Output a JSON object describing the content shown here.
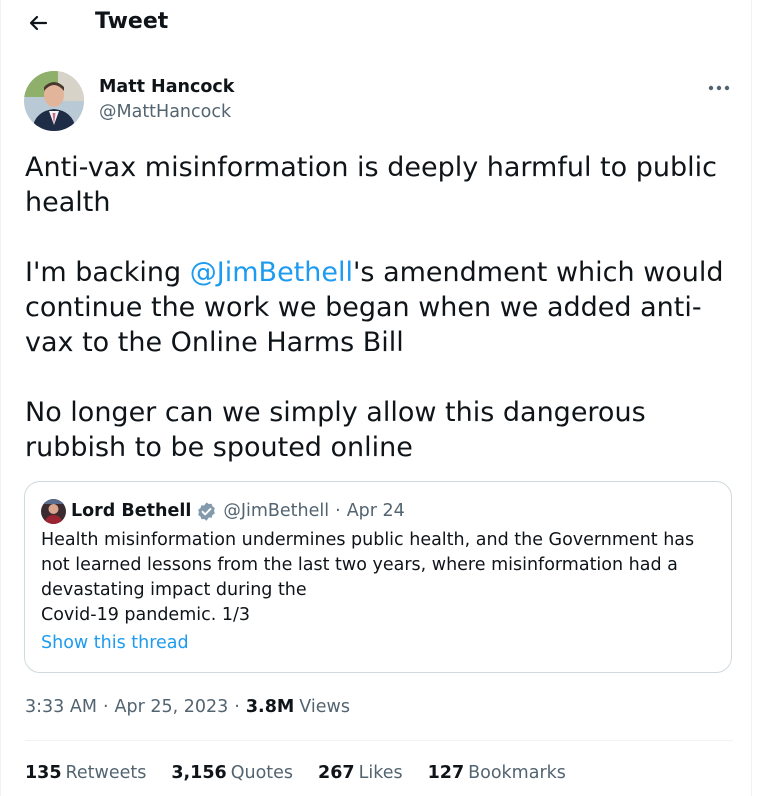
{
  "header": {
    "title": "Tweet",
    "back_icon": "arrow-left-icon"
  },
  "author": {
    "name": "Matt Hancock",
    "handle": "@MattHancock",
    "more_icon": "more-dots-icon"
  },
  "tweet": {
    "p1": "Anti-vax misinformation is deeply harmful to public health",
    "p2_pre": "I'm backing ",
    "p2_mention": "@JimBethell",
    "p2_post": "'s amendment which would continue the work we began when we added anti-vax to the Online Harms Bill",
    "p3": "No longer can we simply allow this dangerous rubbish to be spouted online"
  },
  "quote": {
    "name": "Lord Bethell",
    "handle": "@JimBethell",
    "separator": "·",
    "date": "Apr 24",
    "text": "Health misinformation undermines public health, and the Government has not learned lessons from the last two years, where misinformation had a devastating impact during the\nCovid-19 pandemic. 1/3",
    "show_thread": "Show this thread",
    "verified_color": "#829aab"
  },
  "meta": {
    "time": "3:33 AM",
    "separator": "·",
    "date": "Apr 25, 2023",
    "views_count": "3.8M",
    "views_label": "Views"
  },
  "stats": [
    {
      "count": "135",
      "label": "Retweets"
    },
    {
      "count": "3,156",
      "label": "Quotes"
    },
    {
      "count": "267",
      "label": "Likes"
    },
    {
      "count": "127",
      "label": "Bookmarks"
    }
  ],
  "colors": {
    "text": "#0f1419",
    "secondary": "#536471",
    "accent": "#1d9bf0",
    "border": "#cfd9de"
  }
}
